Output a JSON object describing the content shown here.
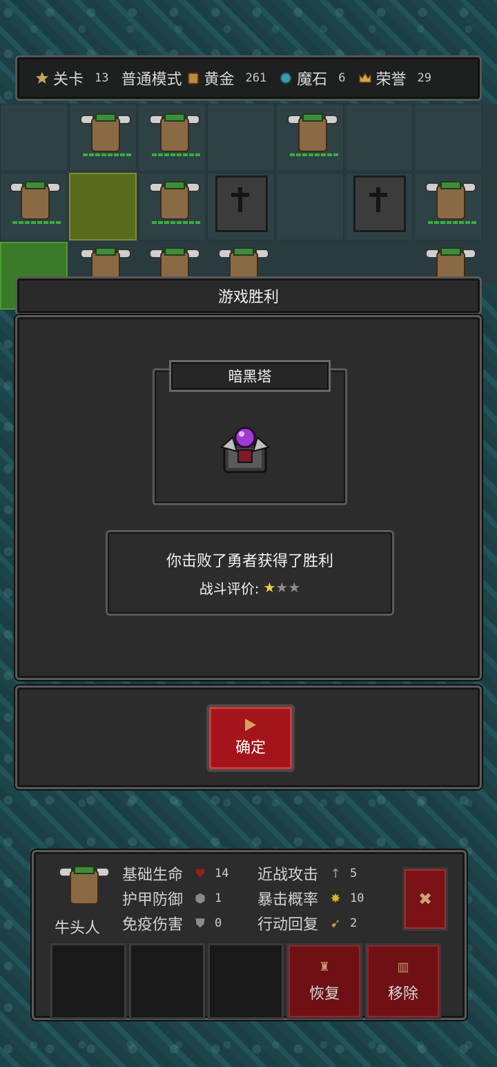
{
  "top_bar": {
    "level_label": "关卡",
    "level_value": "13",
    "mode": "普通模式",
    "gold_label": "黄金",
    "gold_value": "261",
    "magicstone_label": "魔石",
    "magicstone_value": "6",
    "honor_label": "荣誉",
    "honor_value": "29"
  },
  "dialog": {
    "title": "游戏胜利",
    "tower_name": "暗黑塔",
    "message": "你击败了勇者获得了胜利",
    "rating_label": "战斗评价:",
    "rating_stars": 1,
    "rating_max": 3,
    "confirm_label": "确定"
  },
  "unit_info": {
    "name": "牛头人",
    "stats": [
      {
        "label": "基础生命",
        "icon": "heart-icon",
        "glyph": "♥",
        "color": "#9c1c1c",
        "value": "14"
      },
      {
        "label": "近战攻击",
        "icon": "sword-icon",
        "glyph": "↑",
        "color": "#b99664",
        "value": "5"
      },
      {
        "label": "护甲防御",
        "icon": "armor-icon",
        "glyph": "⬢",
        "color": "#8a8a8a",
        "value": "1"
      },
      {
        "label": "暴击概率",
        "icon": "burst-icon",
        "glyph": "✸",
        "color": "#e0b020",
        "value": "10"
      },
      {
        "label": "免疫伤害",
        "icon": "shield-icon",
        "glyph": "⛊",
        "color": "#8a8a8a",
        "value": "0"
      },
      {
        "label": "行动回复",
        "icon": "boot-icon",
        "glyph": "➹",
        "color": "#c99a3a",
        "value": "2"
      }
    ],
    "close_label": "✖",
    "restore_label": "恢复",
    "remove_label": "移除"
  }
}
